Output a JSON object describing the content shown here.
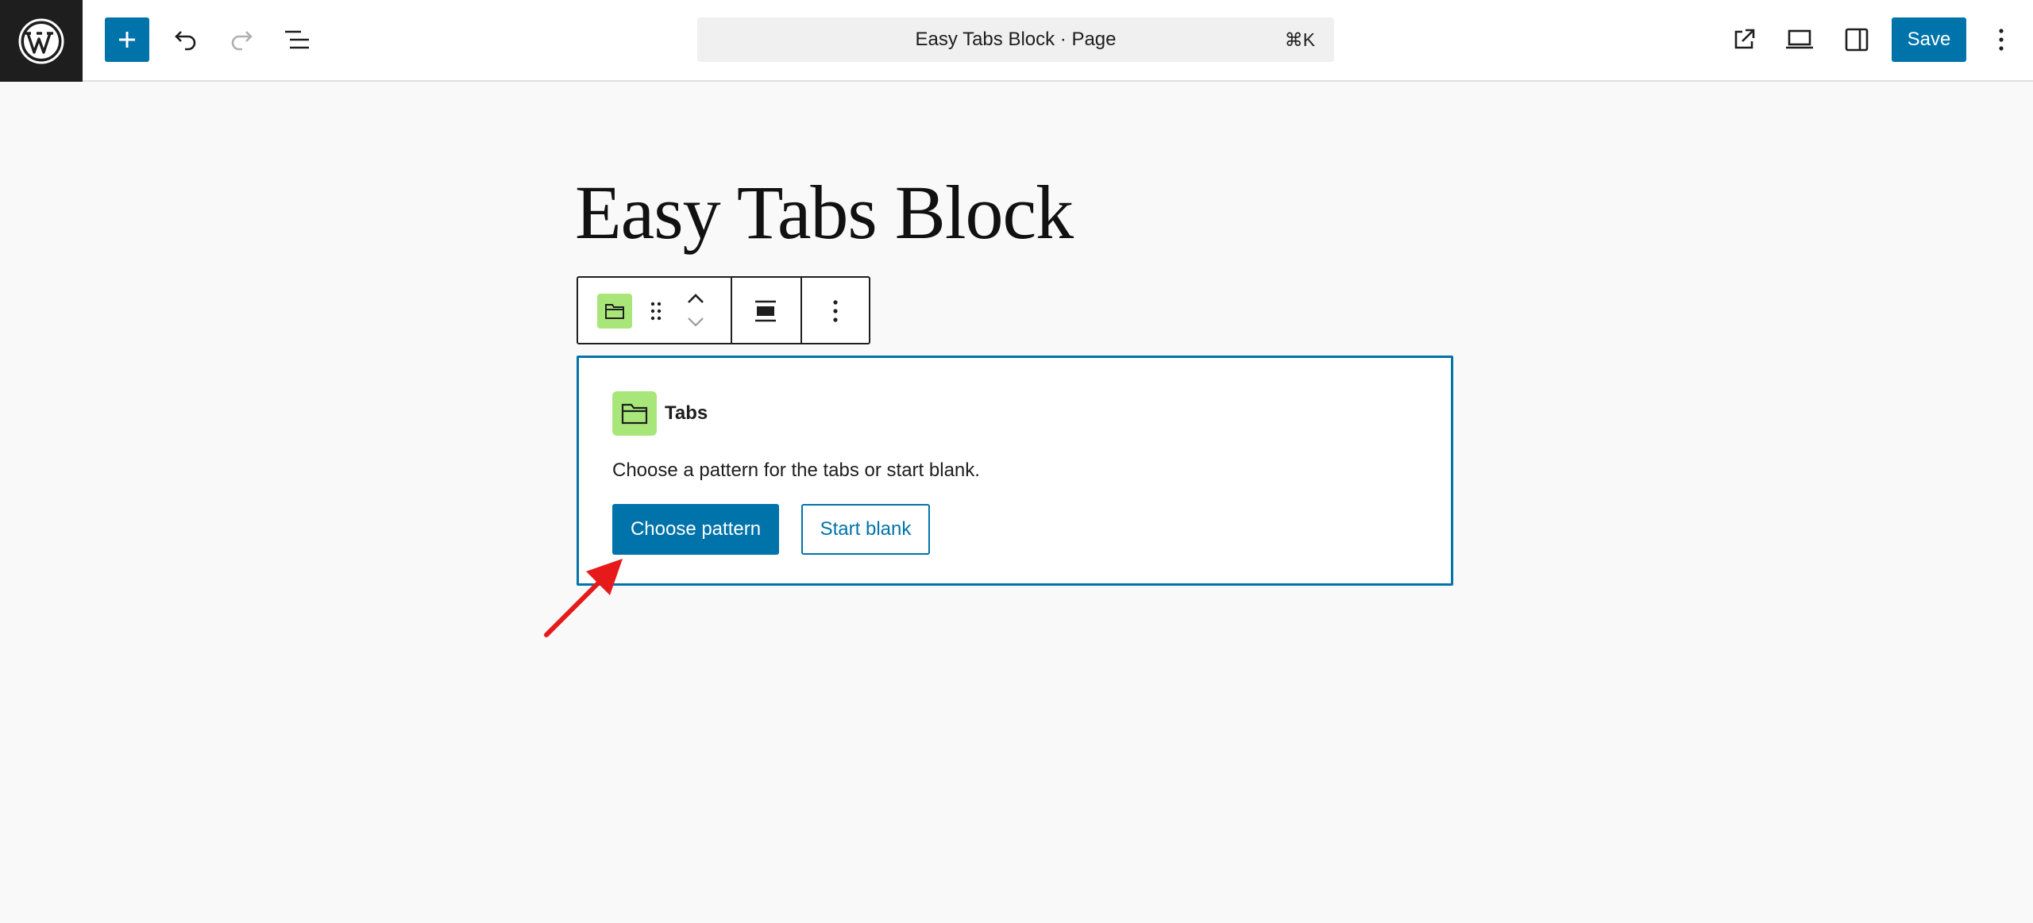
{
  "header": {
    "command_bar": {
      "title": "Easy Tabs Block · Page",
      "shortcut": "⌘K"
    },
    "save_label": "Save",
    "icons": {
      "logo": "wordpress-logo",
      "add": "plus-icon",
      "undo": "undo-icon",
      "redo": "redo-icon",
      "list_view": "list-view-icon",
      "view_page": "external-link-icon",
      "device_preview": "laptop-icon",
      "settings": "sidebar-toggle-icon",
      "options": "more-vertical-icon"
    }
  },
  "page": {
    "title": "Easy Tabs Block"
  },
  "block_toolbar": {
    "icons": {
      "block_type": "folder-icon",
      "drag": "drag-handle-icon",
      "move_up": "chevron-up-icon",
      "move_down": "chevron-down-icon",
      "align": "align-wide-icon",
      "more": "more-vertical-icon"
    }
  },
  "tabs_block": {
    "label": "Tabs",
    "instructions": "Choose a pattern for the tabs or start blank.",
    "choose_pattern_label": "Choose pattern",
    "start_blank_label": "Start blank"
  },
  "colors": {
    "accent": "#0073aa",
    "block_icon_bg": "#a8e67a",
    "annotation": "#e61a1a",
    "topbar_dark": "#1e1e1e"
  }
}
